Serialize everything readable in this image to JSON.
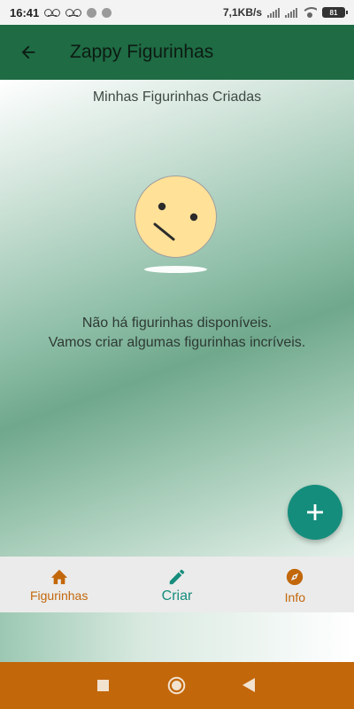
{
  "status_bar": {
    "time": "16:41",
    "network_speed": "7,1KB/s",
    "battery": "81",
    "icons": [
      "voicemail-icon",
      "voicemail-icon",
      "notification-dot-icon",
      "notification-dot-icon",
      "signal-icon",
      "signal-icon",
      "wifi-icon",
      "battery-icon"
    ]
  },
  "app_bar": {
    "title": "Zappy Figurinhas",
    "back_icon": "arrow-back-icon",
    "background": "#1e6b44"
  },
  "main": {
    "page_title": "Minhas Figurinhas Criadas",
    "empty_line1": "Não há figurinhas disponíveis.",
    "empty_line2": "Vamos criar algumas figurinhas incríveis.",
    "empty_icon": "confused-face-icon",
    "fab_icon": "plus-icon",
    "fab_color": "#158d7c"
  },
  "bottom_nav": {
    "items": [
      {
        "label": "Figurinhas",
        "icon": "home-icon",
        "color": "#c2670a",
        "active": false
      },
      {
        "label": "Criar",
        "icon": "pencil-icon",
        "color": "#158d7c",
        "active": true
      },
      {
        "label": "Info",
        "icon": "compass-icon",
        "color": "#c2670a",
        "active": false
      }
    ]
  },
  "system_nav": {
    "background": "#c2670a",
    "buttons": [
      "recents-icon",
      "home-circle-icon",
      "back-triangle-icon"
    ]
  }
}
